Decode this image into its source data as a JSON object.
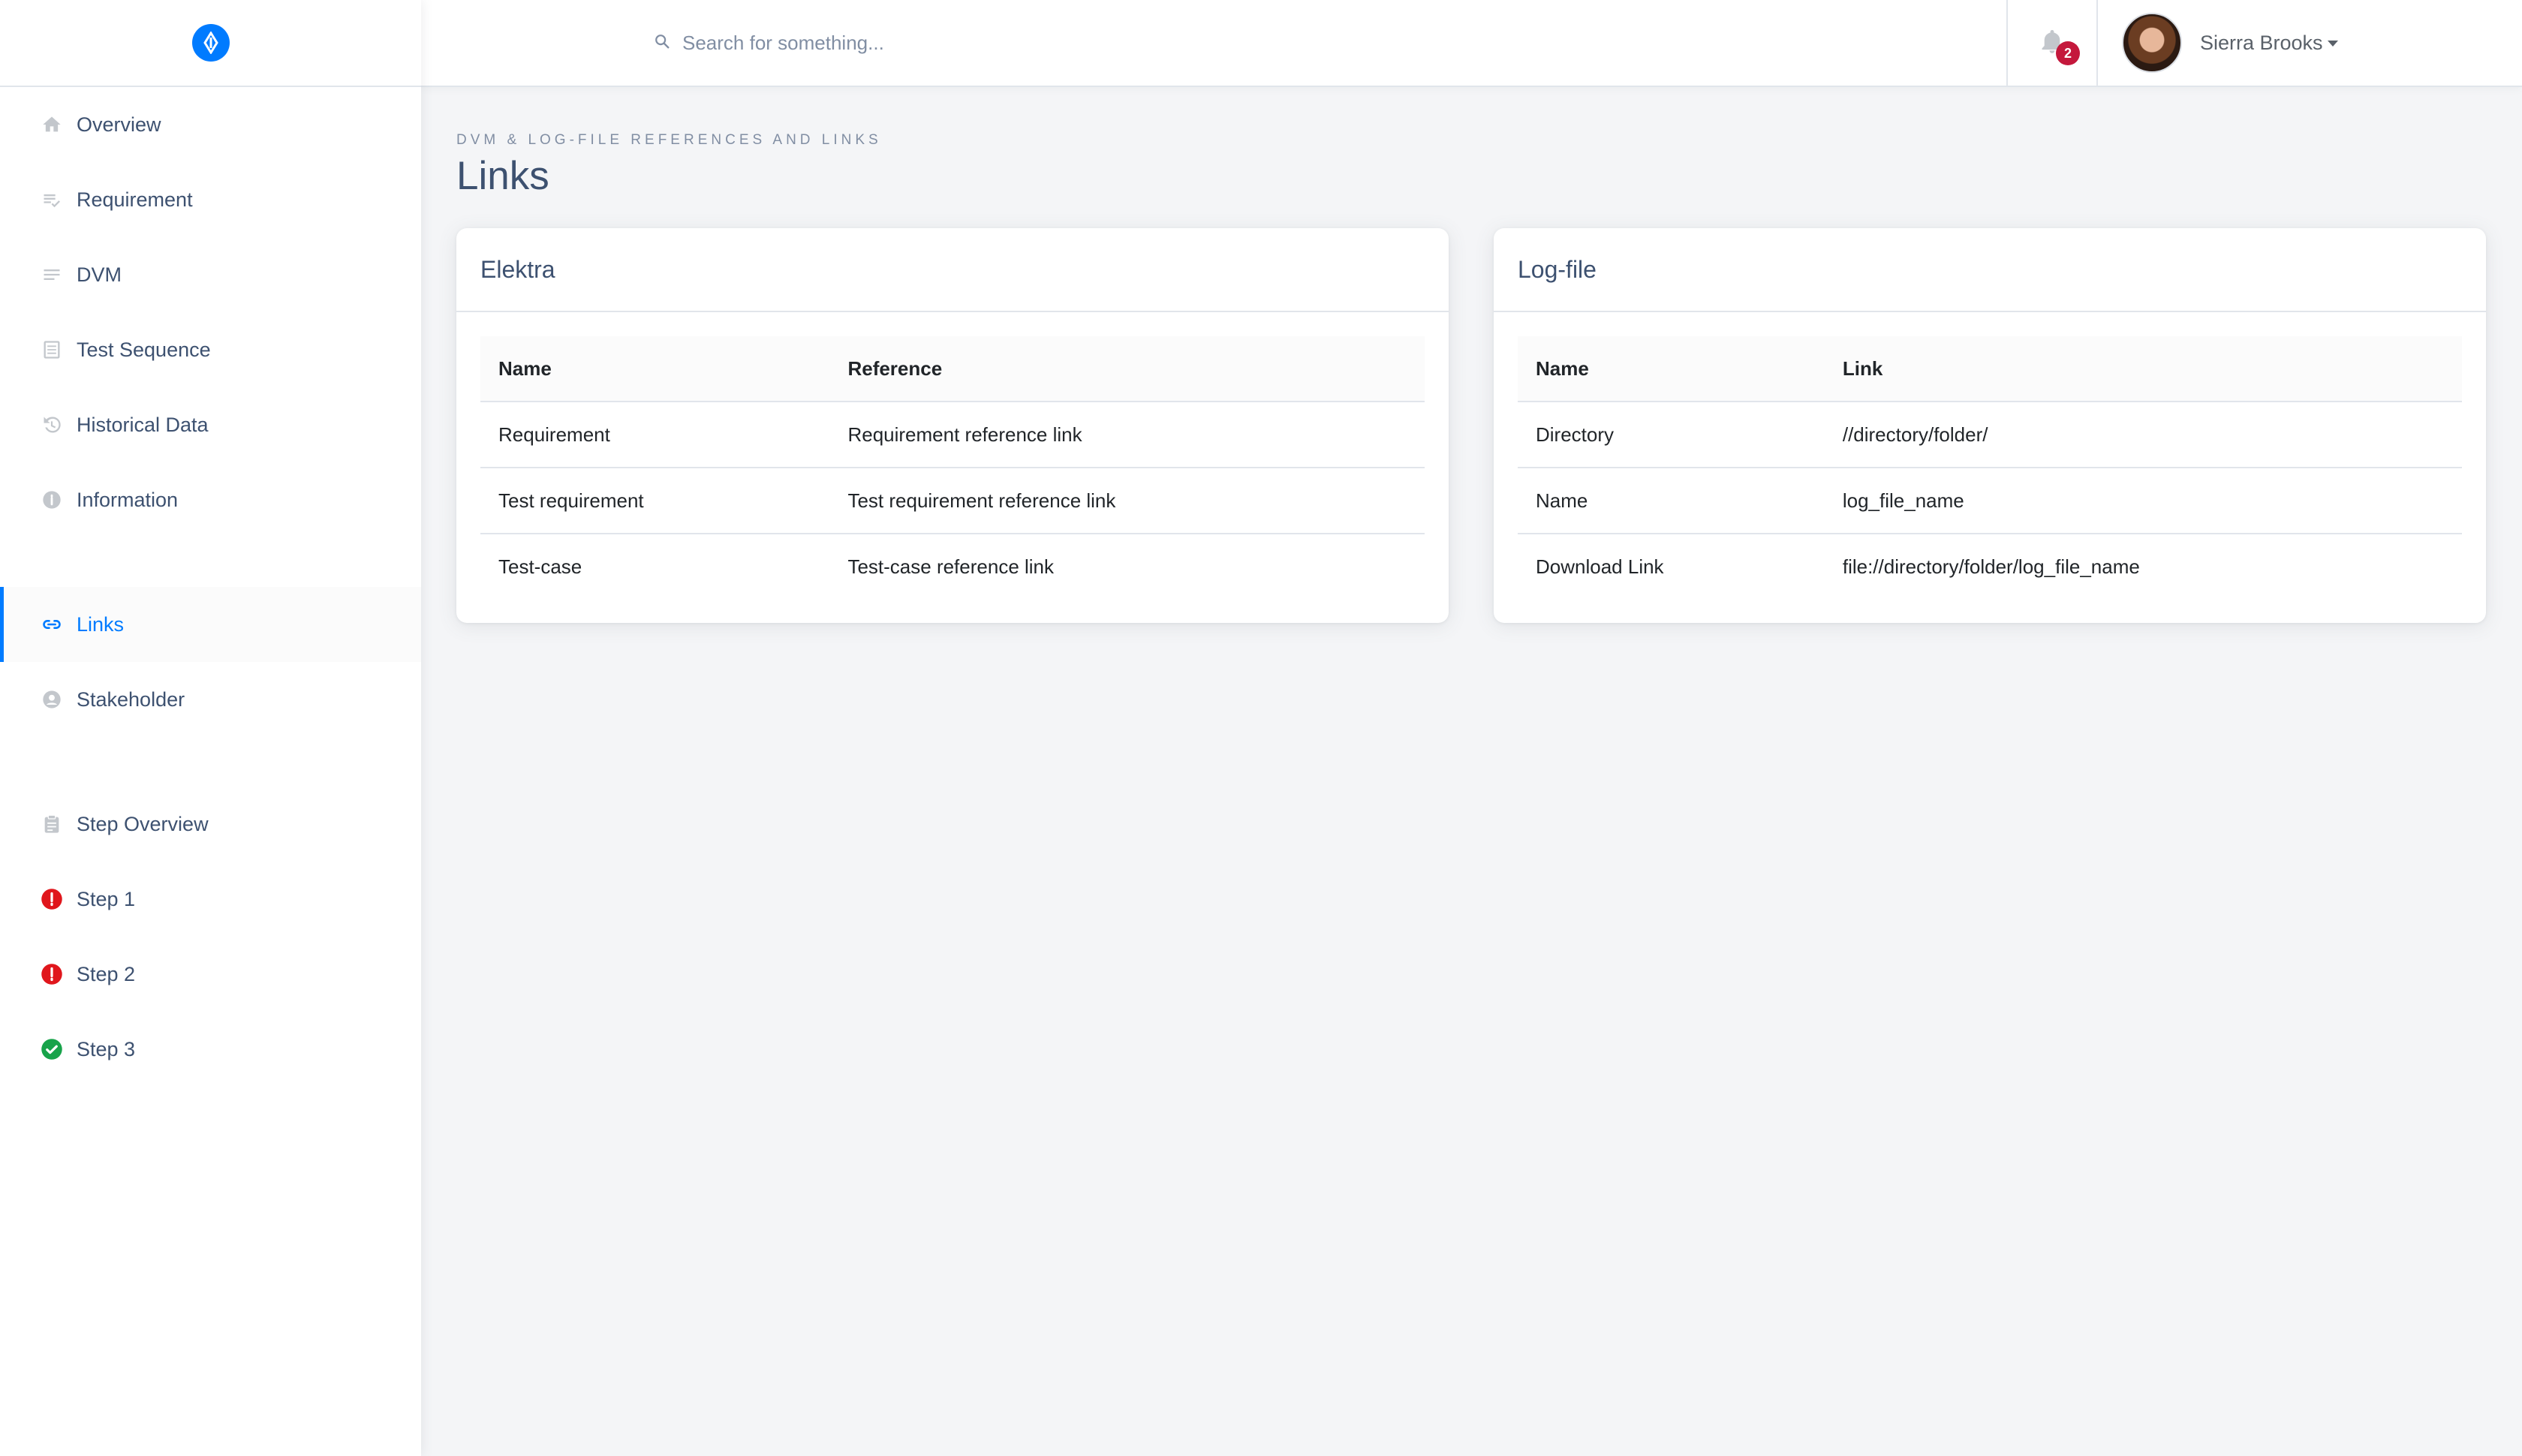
{
  "sidebar": {
    "items": [
      {
        "label": "Overview",
        "icon": "home-icon"
      },
      {
        "label": "Requirement",
        "icon": "checklist-icon"
      },
      {
        "label": "DVM",
        "icon": "lines-icon"
      },
      {
        "label": "Test Sequence",
        "icon": "list-box-icon"
      },
      {
        "label": "Historical Data",
        "icon": "history-icon"
      },
      {
        "label": "Information",
        "icon": "info-icon"
      },
      {
        "label": "Links",
        "icon": "link-icon",
        "active": true
      },
      {
        "label": "Stakeholder",
        "icon": "person-icon"
      },
      {
        "label": "Step Overview",
        "icon": "clipboard-icon"
      },
      {
        "label": "Step 1",
        "icon": "error-icon",
        "status_color": "#e0161c"
      },
      {
        "label": "Step 2",
        "icon": "error-icon",
        "status_color": "#e0161c"
      },
      {
        "label": "Step 3",
        "icon": "check-circle-icon",
        "status_color": "#17a34a"
      }
    ]
  },
  "header": {
    "search_placeholder": "Search for something...",
    "notification_count": "2",
    "user_name": "Sierra Brooks"
  },
  "page": {
    "subtitle": "DVM & Log-File References and Links",
    "title": "Links"
  },
  "cards": {
    "elektra": {
      "title": "Elektra",
      "headers": [
        "Name",
        "Reference"
      ],
      "rows": [
        [
          "Requirement",
          "Requirement reference link"
        ],
        [
          "Test requirement",
          "Test requirement reference link"
        ],
        [
          "Test-case",
          "Test-case reference link"
        ]
      ]
    },
    "logfile": {
      "title": "Log-file",
      "headers": [
        "Name",
        "Link"
      ],
      "rows": [
        [
          "Directory",
          "//directory/folder/"
        ],
        [
          "Name",
          "log_file_name"
        ],
        [
          "Download Link",
          "file://directory/folder/log_file_name"
        ]
      ]
    }
  },
  "colors": {
    "accent": "#007bff",
    "badge": "#c4183c",
    "error": "#e0161c",
    "success": "#17a34a"
  }
}
